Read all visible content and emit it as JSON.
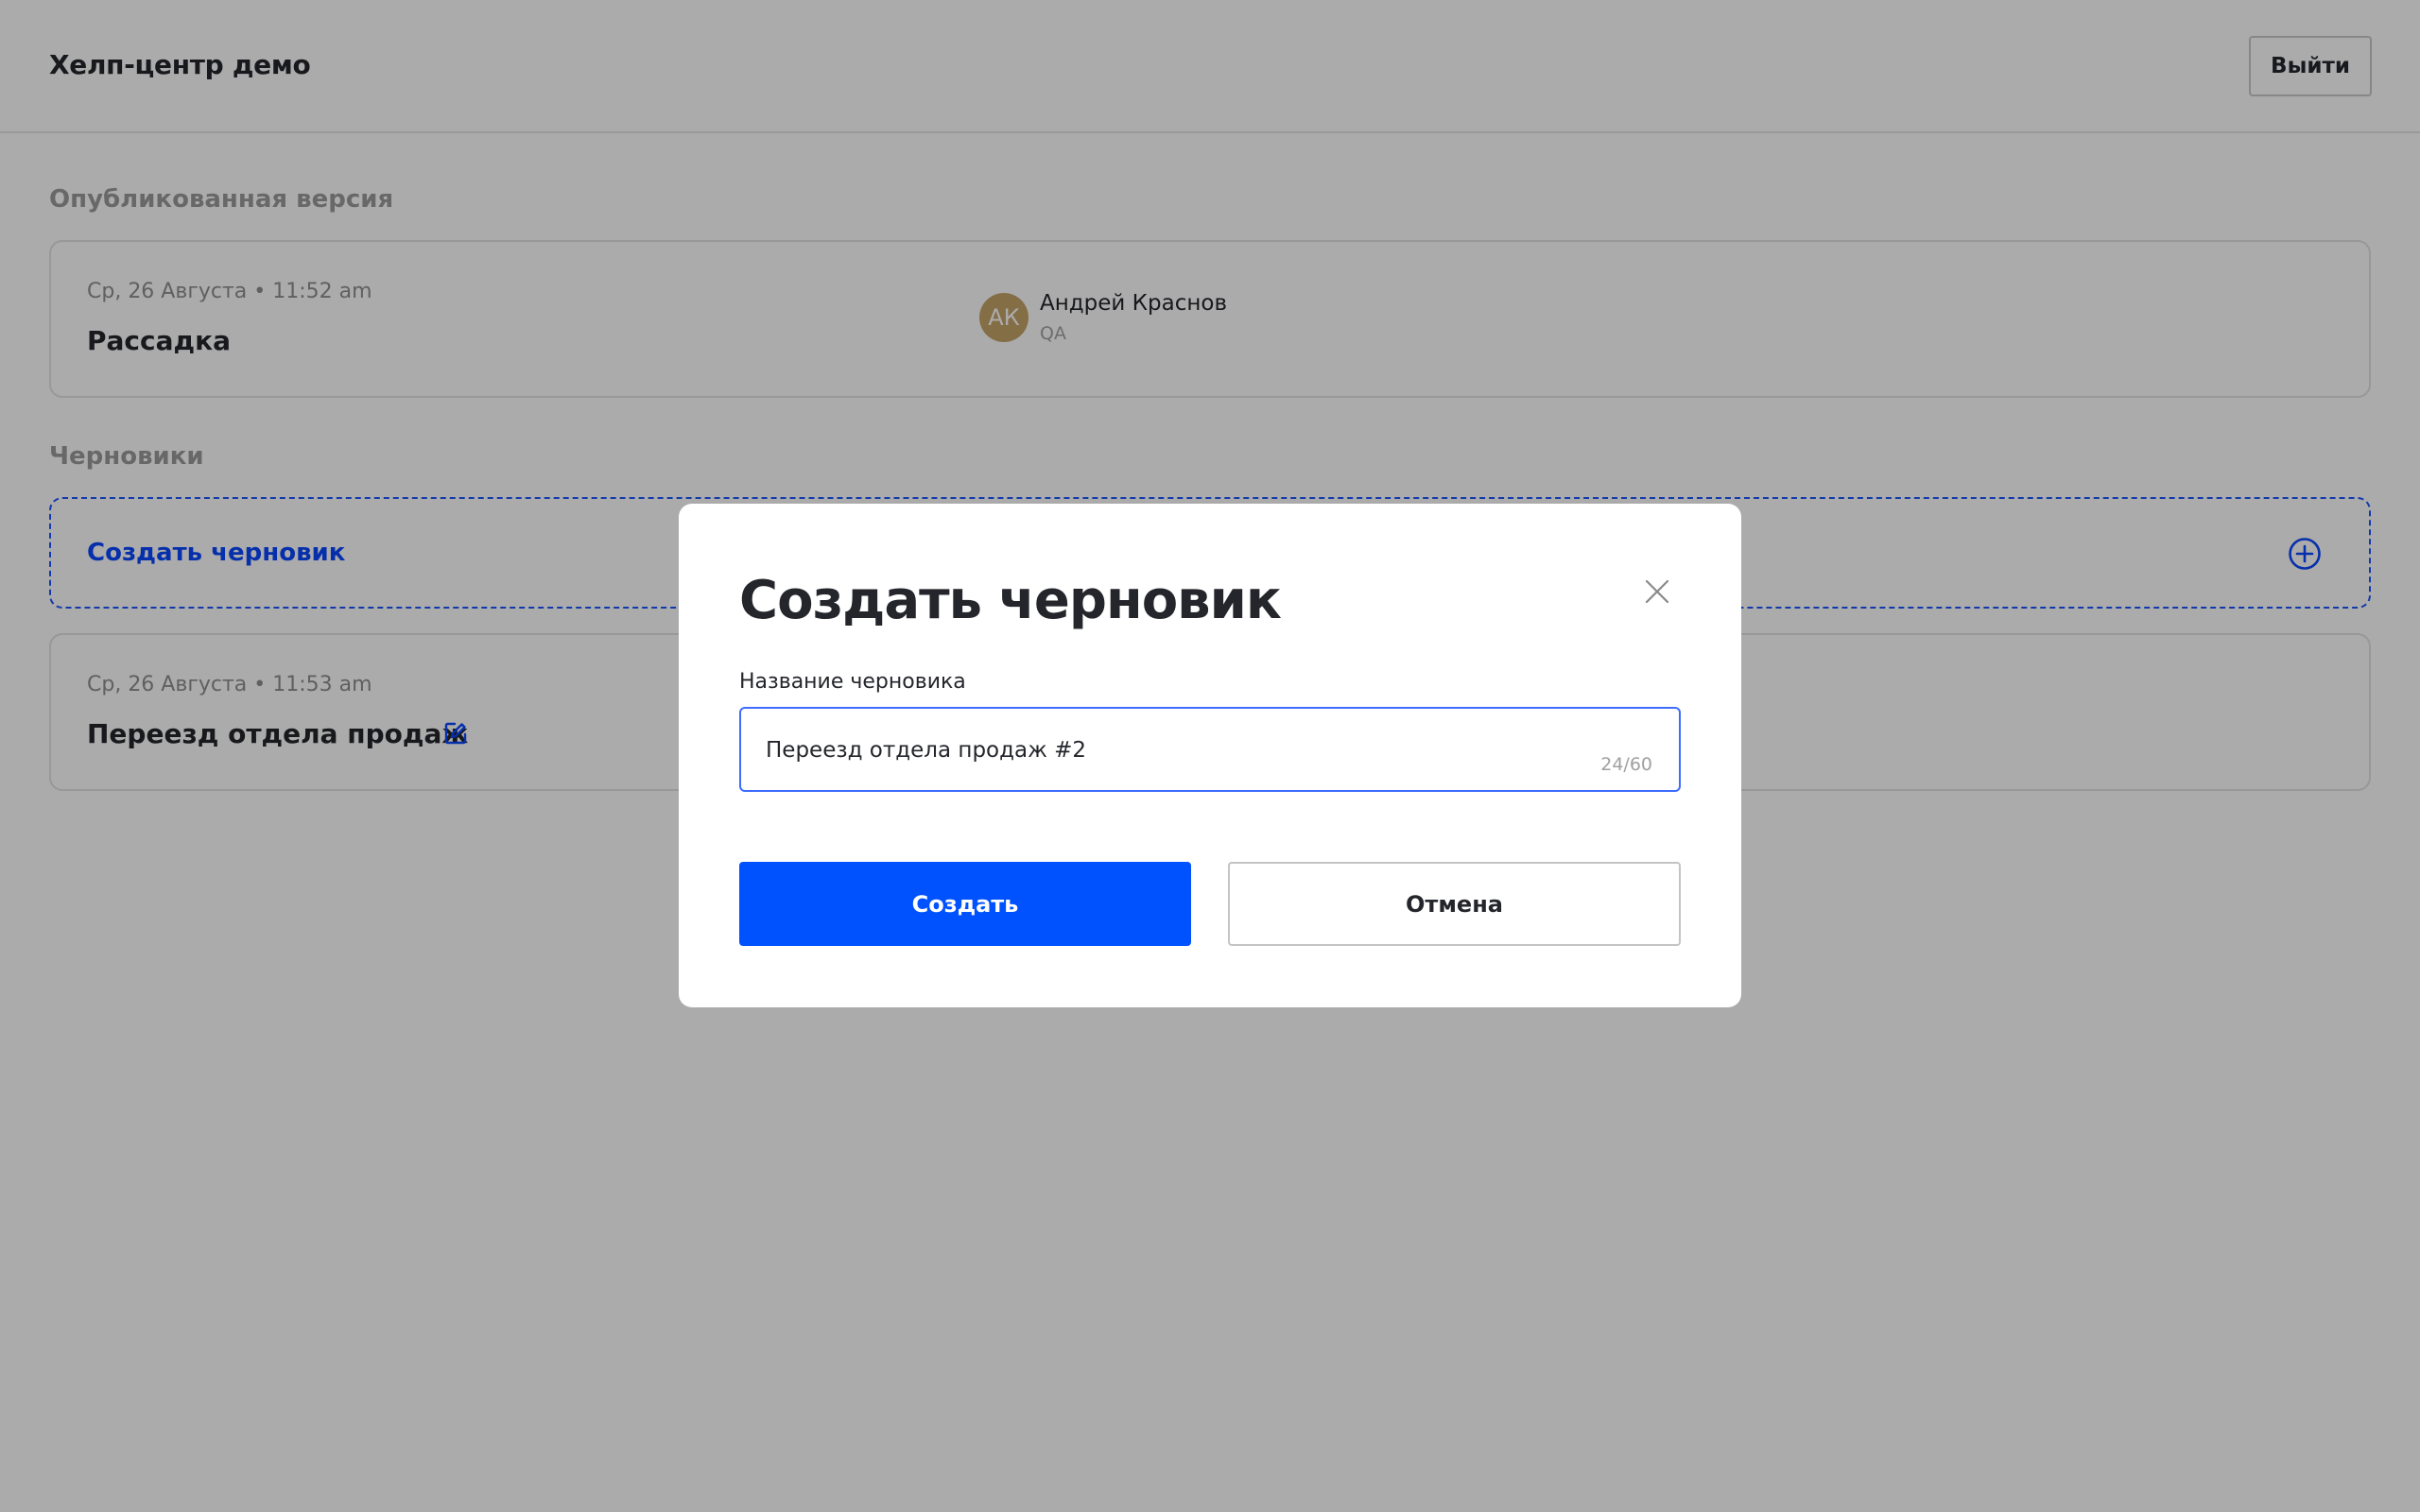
{
  "header": {
    "app_title": "Хелп-центр демо",
    "logout_label": "Выйти"
  },
  "published": {
    "section_title": "Опубликованная версия",
    "card": {
      "date": "Ср, 26 Августа • 11:52 am",
      "title": "Рассадка",
      "author": {
        "initials": "АК",
        "name": "Андрей Краснов",
        "role": "QA",
        "avatar_color": "#c5a469"
      }
    }
  },
  "drafts": {
    "section_title": "Черновики",
    "create_label": "Создать черновик",
    "create_icon": "plus-circle-icon",
    "items": [
      {
        "date": "Ср, 26 Августа • 11:53 am",
        "title": "Переезд отдела продаж",
        "icon": "edit-icon"
      }
    ]
  },
  "modal": {
    "title": "Создать черновик",
    "close_icon": "close-icon",
    "field_label": "Название черновика",
    "field_value": "Переезд отдела продаж #2",
    "char_counter": "24/60",
    "create_label": "Создать",
    "cancel_label": "Отмена"
  },
  "colors": {
    "accent": "#0052ff",
    "text": "#24262b",
    "muted": "#8f8f8f",
    "overlay": "rgba(0,0,0,0.33)"
  }
}
